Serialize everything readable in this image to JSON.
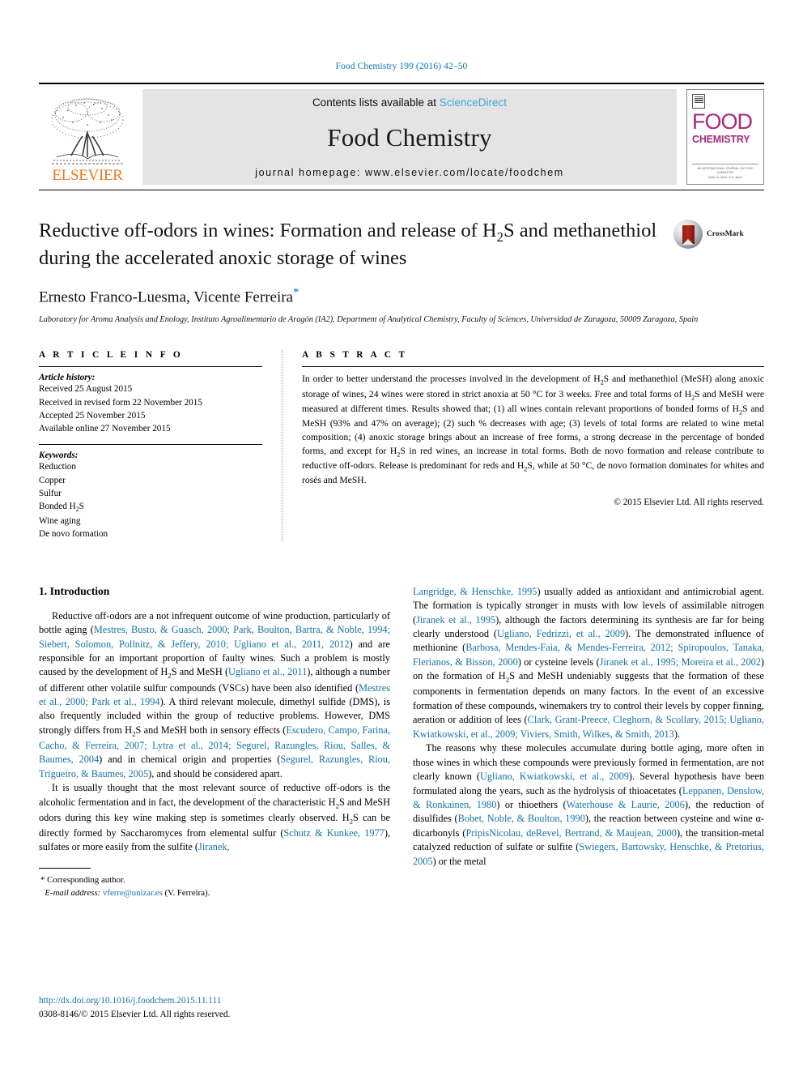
{
  "running_head": "Food Chemistry 199 (2016) 42–50",
  "masthead": {
    "publisher_wordmark": "ELSEVIER",
    "contents_prefix": "Contents lists available at ",
    "contents_link": "ScienceDirect",
    "journal_name": "Food Chemistry",
    "homepage": "journal homepage: www.elsevier.com/locate/foodchem",
    "cover": {
      "line1": "FOOD",
      "line2": "CHEMISTRY",
      "footer1": "AN INTERNATIONAL JOURNAL ON FOOD CHEMISTRY",
      "footer2": "Editor-in-Chief: G.G. Birch"
    }
  },
  "article": {
    "title_line1": "Reductive off-odors in wines: Formation and release of H",
    "title_sub1": "2",
    "title_line1b": "S and",
    "title_line2": "methanethiol during the accelerated anoxic storage of wines",
    "authors": "Ernesto Franco-Luesma, Vicente Ferreira",
    "corresponding_marker": "*",
    "affiliation": "Laboratory for Aroma Analysis and Enology, Instituto Agroalimentario de Aragón (IA2), Department of Analytical Chemistry, Faculty of Sciences, Universidad de Zaragoza, 50009 Zaragoza, Spain",
    "crossmark_label": "CrossMark"
  },
  "article_info": {
    "heading": "A R T I C L E  I N F O",
    "history_label": "Article history:",
    "history": [
      "Received 25 August 2015",
      "Received in revised form 22 November 2015",
      "Accepted 25 November 2015",
      "Available online 27 November 2015"
    ],
    "keywords_label": "Keywords:",
    "keywords": [
      "Reduction",
      "Copper",
      "Sulfur",
      "Bonded H2S",
      "Wine aging",
      "De novo formation"
    ]
  },
  "abstract": {
    "heading": "A B S T R A C T",
    "text": "In order to better understand the processes involved in the development of H2S and methanethiol (MeSH) along anoxic storage of wines, 24 wines were stored in strict anoxia at 50 °C for 3 weeks. Free and total forms of H2S and MeSH were measured at different times. Results showed that; (1) all wines contain relevant proportions of bonded forms of H2S and MeSH (93% and 47% on average); (2) such % decreases with age; (3) levels of total forms are related to wine metal composition; (4) anoxic storage brings about an increase of free forms, a strong decrease in the percentage of bonded forms, and except for H2S in red wines, an increase in total forms. Both de novo formation and release contribute to reductive off-odors. Release is predominant for reds and H2S, while at 50 °C, de novo formation dominates for whites and rosés and MeSH.",
    "copyright": "© 2015 Elsevier Ltd. All rights reserved."
  },
  "intro": {
    "heading": "1. Introduction",
    "p1_a": "Reductive off-odors are a not infrequent outcome of wine production, particularly of bottle aging (",
    "p1_cite1": "Mestres, Busto, & Guasch, 2000; Park, Boulton, Bartra, & Noble, 1994; Siebert, Solomon, Pollnitz, & Jeffery, 2010; Ugliano et al., 2011, 2012",
    "p1_b": ") and are responsible for an important proportion of faulty wines. Such a problem is mostly caused by the development of H2S and MeSH (",
    "p1_cite2": "Ugliano et al., 2011",
    "p1_c": "), although a number of different other volatile sulfur compounds (VSCs) have been also identified (",
    "p1_cite3": "Mestres et al., 2000; Park et al., 1994",
    "p1_d": "). A third relevant molecule, dimethyl sulfide (DMS), is also frequently included within the group of reductive problems. However, DMS strongly differs from H2S and MeSH both in sensory effects (",
    "p1_cite4": "Escudero, Campo, Farina, Cacho, & Ferreira, 2007; Lytra et al., 2014; Segurel, Razungles, Riou, Salles, & Baumes, 2004",
    "p1_e": ") and in chemical origin and properties (",
    "p1_cite5": "Segurel, Razungles, Riou, Trigueiro, & Baumes, 2005",
    "p1_f": "), and should be considered apart.",
    "p2_a": "It is usually thought that the most relevant source of reductive off-odors is the alcoholic fermentation and in fact, the development of the characteristic H2S and MeSH odors during this key wine making step is sometimes clearly observed. H2S can be directly formed by Saccharomyces from elemental sulfur (",
    "p2_cite1": "Schutz & Kunkee, 1977",
    "p2_b": "), sulfates or more easily from the sulfite (",
    "p2_cite2": "Jiranek, Langridge, & Henschke, 1995",
    "p2_c": ") usually added as antioxidant and antimicrobial agent. The formation is typically stronger in musts with low levels of assimilable nitrogen (",
    "p2_cite3": "Jiranek et al., 1995",
    "p2_d": "), although the factors determining its synthesis are far for being clearly understood (",
    "p2_cite4": "Ugliano, Fedrizzi, et al., 2009",
    "p2_e": "). The demonstrated influence of methionine (",
    "p2_cite5": "Barbosa, Mendes-Faia, & Mendes-Ferreira, 2012; Spiropoulos, Tanaka, Flerianos, & Bisson, 2000",
    "p2_f": ") or cysteine levels (",
    "p2_cite6": "Jiranek et al., 1995; Moreira et al., 2002",
    "p2_g": ") on the formation of H2S and MeSH undeniably suggests that the formation of these components in fermentation depends on many factors. In the event of an excessive formation of these compounds, winemakers try to control their levels by copper finning, aeration or addition of lees (",
    "p2_cite7": "Clark, Grant-Preece, Cleghorn, & Scollary, 2015; Ugliano, Kwiatkowski, et al., 2009; Viviers, Smith, Wilkes, & Smith, 2013",
    "p2_h": ").",
    "p3_a": "The reasons why these molecules accumulate during bottle aging, more often in those wines in which these compounds were previously formed in fermentation, are not clearly known (",
    "p3_cite1": "Ugliano, Kwiatkowski, et al., 2009",
    "p3_b": "). Several hypothesis have been formulated along the years, such as the hydrolysis of thioacetates (",
    "p3_cite2": "Leppanen, Denslow, & Ronkainen, 1980",
    "p3_c": ") or thioethers (",
    "p3_cite3": "Waterhouse & Laurie, 2006",
    "p3_d": "), the reduction of disulfides (",
    "p3_cite4": "Bobet, Noble, & Boulton, 1990",
    "p3_e": "), the reaction between cysteine and wine α-dicarbonyls (",
    "p3_cite5": "PripisNicolau, deRevel, Bertrand, & Maujean, 2000",
    "p3_f": "), the transition-metal catalyzed reduction of sulfate or sulfite (",
    "p3_cite6": "Swiegers, Bartowsky, Henschke, & Pretorius, 2005",
    "p3_g": ") or the metal"
  },
  "footnote": {
    "marker": "*",
    "corresponding": " Corresponding author.",
    "email_label": "E-mail address:",
    "email": "vferre@unizar.es",
    "email_owner": " (V. Ferreira)."
  },
  "footer": {
    "doi": "http://dx.doi.org/10.1016/j.foodchem.2015.11.111",
    "issn_copyright": "0308-8146/© 2015 Elsevier Ltd. All rights reserved."
  },
  "colors": {
    "link": "#1474a4",
    "running_head": "#0b7ab0",
    "elsevier_orange": "#E87722",
    "cover_magenta": "#A52A7E",
    "masthead_gray": "#e4e4e4"
  }
}
